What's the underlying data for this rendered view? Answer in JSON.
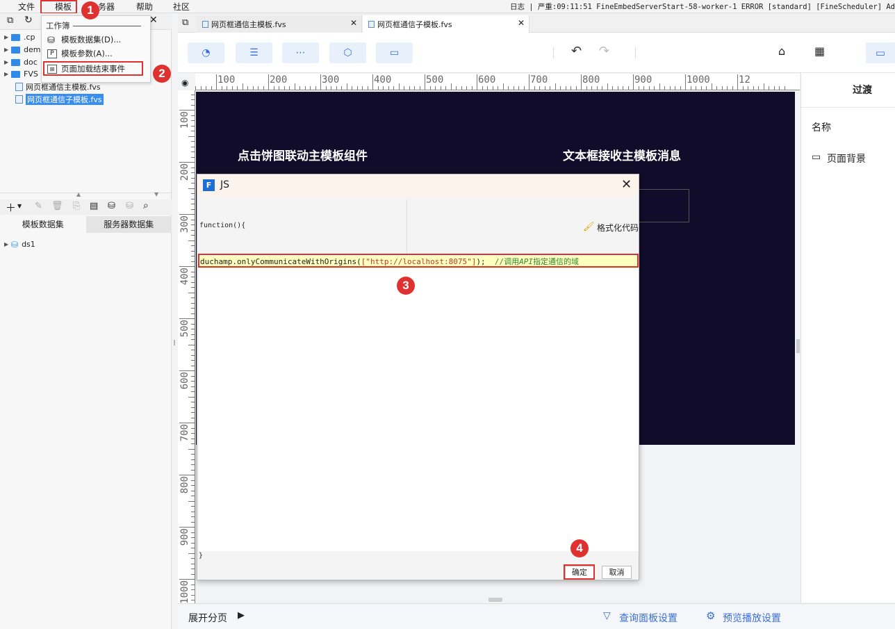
{
  "menubar": {
    "items": [
      "文件",
      "模板",
      "务器",
      "帮助",
      "社区"
    ],
    "log": "日志 | 严重:09:11:51 FineEmbedServerStart-58-worker-1 ERROR [standard] [FineScheduler] Ad"
  },
  "dropdown": {
    "section": "工作簿",
    "items": [
      "模板数据集(D)...",
      "模板参数(A)...",
      "页面加载结束事件"
    ]
  },
  "file_tree": [
    ".cp",
    "dem",
    "doc",
    "FVS",
    "网页框通信主模板.fvs",
    "网页框通信子模板.fvs"
  ],
  "dataset_tabs": [
    "模板数据集",
    "服务器数据集"
  ],
  "datasets": [
    "ds1"
  ],
  "doc_tabs": [
    "网页框通信主模板.fvs",
    "网页框通信子模板.fvs"
  ],
  "ruler_top": [
    "100",
    "200",
    "300",
    "400",
    "500",
    "600",
    "700",
    "800",
    "900",
    "1000",
    "12"
  ],
  "ruler_left": [
    "100",
    "200",
    "300",
    "400",
    "500",
    "600",
    "700",
    "800",
    "900",
    "1000"
  ],
  "canvas": {
    "left_title": "点击饼图联动主模板组件",
    "right_title": "文本框接收主模板消息"
  },
  "right_panel": {
    "header": "过渡",
    "name_label": "名称",
    "bg_label": "页面背景"
  },
  "bottom": {
    "expand": "展开分页",
    "query": "查询面板设置",
    "preview": "预览播放设置"
  },
  "dialog": {
    "title": "JS",
    "fn_start": "function(){",
    "format_label": "格式化代码",
    "code_fn": "duchamp.onlyCommunicateWithOrigins(",
    "code_arg": "[\"http://localhost:8075\"]",
    "code_end": ");",
    "code_comment_pre": "//调用",
    "code_comment_api": "API",
    "code_comment_post": "指定通信的域",
    "fn_end": "}",
    "ok": "确定",
    "cancel": "取消"
  },
  "badges": [
    "1",
    "2",
    "3",
    "4"
  ]
}
